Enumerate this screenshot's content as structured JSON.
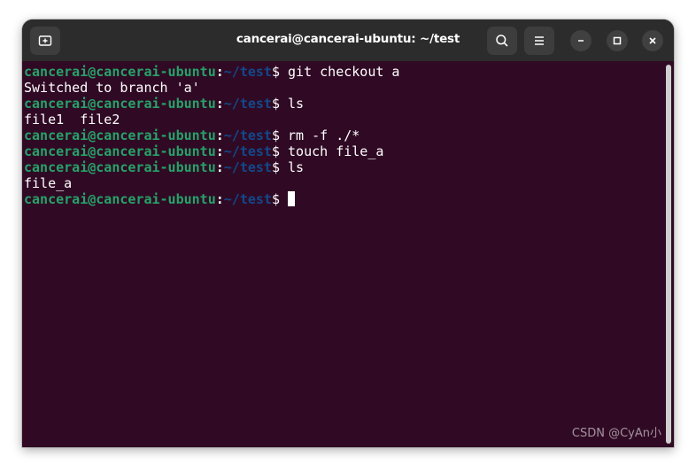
{
  "window": {
    "title": "cancerai@cancerai-ubuntu: ~/test"
  },
  "titlebar_icons": {
    "new_tab": "new-tab-icon",
    "search": "search-icon",
    "menu": "hamburger-menu-icon",
    "minimize": "minimize-icon",
    "maximize": "maximize-icon",
    "close": "close-icon"
  },
  "terminal": {
    "prompt": {
      "user_host": "cancerai@cancerai-ubuntu",
      "colon": ":",
      "path": "~/test",
      "symbol": "$"
    },
    "lines": [
      {
        "type": "prompt",
        "command": " git checkout a"
      },
      {
        "type": "output",
        "text": "Switched to branch 'a'"
      },
      {
        "type": "prompt",
        "command": " ls"
      },
      {
        "type": "output",
        "text": "file1  file2"
      },
      {
        "type": "prompt",
        "command": " rm -f ./*"
      },
      {
        "type": "prompt",
        "command": " touch file_a"
      },
      {
        "type": "prompt",
        "command": " ls"
      },
      {
        "type": "output",
        "text": "file_a"
      },
      {
        "type": "prompt",
        "command": " "
      }
    ]
  },
  "colors": {
    "background": "#300a24",
    "user_host": "#26a269",
    "path": "#12488b",
    "text": "#ffffff",
    "titlebar": "#2c2c2c"
  },
  "watermark": "CSDN @CyAn小"
}
